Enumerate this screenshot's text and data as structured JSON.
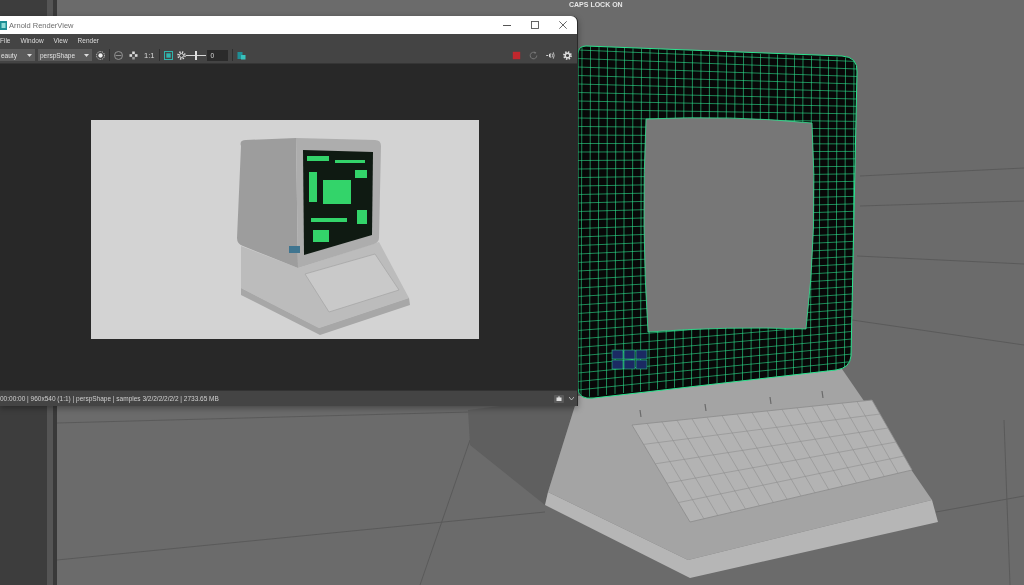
{
  "viewport": {
    "hud_text": "CAPS LOCK ON"
  },
  "render_window": {
    "title": "Arnold RenderView",
    "menu": [
      "File",
      "Window",
      "View",
      "Render"
    ],
    "toolbar": {
      "aov": "eauty",
      "camera": "perspShape",
      "ratio_label": "1:1",
      "exposure_slider": {
        "level": 0.5
      },
      "exposure_value": "0"
    },
    "status_bar": "00:00:00 | 960x540 (1:1) | perspShape | samples 3/2/2/2/2/2/2 | 2733.65 MB"
  }
}
